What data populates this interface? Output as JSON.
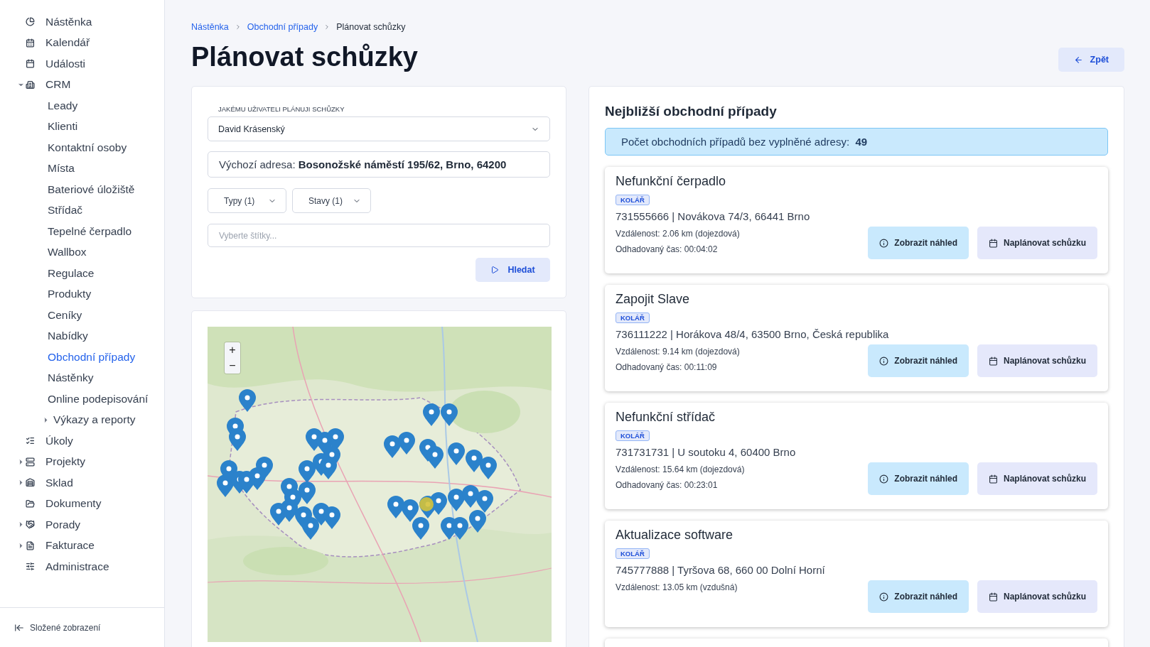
{
  "sidebar": {
    "items": [
      {
        "label": "Nástěnka",
        "kind": "pie",
        "selected": false
      },
      {
        "label": "Kalendář",
        "kind": "calendar",
        "selected": false
      },
      {
        "label": "Události",
        "kind": "grid-calendar",
        "selected": false
      },
      {
        "label": "CRM",
        "kind": "building",
        "selected": false,
        "expanded": true,
        "children": [
          {
            "label": "Leady",
            "selected": false
          },
          {
            "label": "Klienti",
            "selected": false
          },
          {
            "label": "Kontaktní osoby",
            "selected": false
          },
          {
            "label": "Místa",
            "selected": false
          },
          {
            "label": "Bateriové úložiště",
            "selected": false
          },
          {
            "label": "Střídač",
            "selected": false
          },
          {
            "label": "Tepelné čerpadlo",
            "selected": false
          },
          {
            "label": "Wallbox",
            "selected": false
          },
          {
            "label": "Regulace",
            "selected": false
          },
          {
            "label": "Produkty",
            "selected": false
          },
          {
            "label": "Ceníky",
            "selected": false
          },
          {
            "label": "Nabídky",
            "selected": false
          },
          {
            "label": "Obchodní případy",
            "selected": true
          },
          {
            "label": "Nástěnky",
            "selected": false
          },
          {
            "label": "Online podepisování",
            "selected": false
          },
          {
            "label": "Výkazy a reporty",
            "selected": false,
            "expanded": false
          }
        ]
      },
      {
        "label": "Úkoly",
        "kind": "list",
        "selected": false
      },
      {
        "label": "Projekty",
        "kind": "server",
        "selected": false,
        "expanded": false
      },
      {
        "label": "Sklad",
        "kind": "warehouse",
        "selected": false,
        "expanded": false
      },
      {
        "label": "Dokumenty",
        "kind": "folder",
        "selected": false
      },
      {
        "label": "Porady",
        "kind": "handshake",
        "selected": false,
        "expanded": false
      },
      {
        "label": "Fakturace",
        "kind": "file",
        "selected": false,
        "expanded": false
      },
      {
        "label": "Administrace",
        "kind": "sliders",
        "selected": false
      }
    ],
    "footer": "Složené zobrazení"
  },
  "breadcrumb": [
    {
      "label": "Nástěnka",
      "link": true
    },
    {
      "label": "Obchodní případy",
      "link": true
    },
    {
      "label": "Plánovat schůzky",
      "link": false
    }
  ],
  "page_title": "Plánovat schůzky",
  "back_button": "Zpět",
  "form": {
    "user_label": "JAKÉMU UŽIVATELI PLÁNUJI SCHŮZKY",
    "user_value": "David Krásenský",
    "address_label": "Výchozí adresa:",
    "address_value": "Bosonožské náměstí 195/62, Brno, 64200",
    "filters": [
      "Typy (1)",
      "Stavy (1)"
    ],
    "tags": {
      "placeholder": "Vyberte štítky..."
    },
    "search_button": "Hledat"
  },
  "map": {
    "kind": "picture",
    "zoom_in": "+",
    "zoom_out": "−"
  },
  "nearest": {
    "title": "Nejbližší obchodní případy",
    "info_text": "Počet obchodních případů bez vyplněné adresy:",
    "info_count": "49",
    "cases": [
      {
        "title": "Nefunkční čerpadlo",
        "tag": "KOLÁŘ",
        "contact": "731555666 | Novákova 74/3, 66441 Brno",
        "distance": "Vzdálenost: 2.06 km (dojezdová)",
        "time": "Odhadovaný čas: 00:04:02",
        "preview_button": "Zobrazit náhled",
        "schedule_button": "Naplánovat schůzku"
      },
      {
        "title": "Zapojit Slave",
        "tag": "KOLÁŘ",
        "contact": "736111222 | Horákova 48/4, 63500 Brno, Česká republika",
        "distance": "Vzdálenost: 9.14 km (dojezdová)",
        "time": "Odhadovaný čas: 00:11:09",
        "preview_button": "Zobrazit náhled",
        "schedule_button": "Naplánovat schůzku"
      },
      {
        "title": "Nefunkční střídač",
        "tag": "KOLÁŘ",
        "contact": "731731731 | U soutoku 4, 60400 Brno",
        "distance": "Vzdálenost: 15.64 km (dojezdová)",
        "time": "Odhadovaný čas: 00:23:01",
        "preview_button": "Zobrazit náhled",
        "schedule_button": "Naplánovat schůzku"
      },
      {
        "title": "Aktualizace software",
        "tag": "KOLÁŘ",
        "contact": "745777888 | Tyršova 68, 660 00 Dolní Horní",
        "distance": "Vzdálenost: 13.05 km (vzdušná)",
        "preview_button": "Zobrazit náhled",
        "schedule_button": "Naplánovat schůzku"
      }
    ]
  }
}
